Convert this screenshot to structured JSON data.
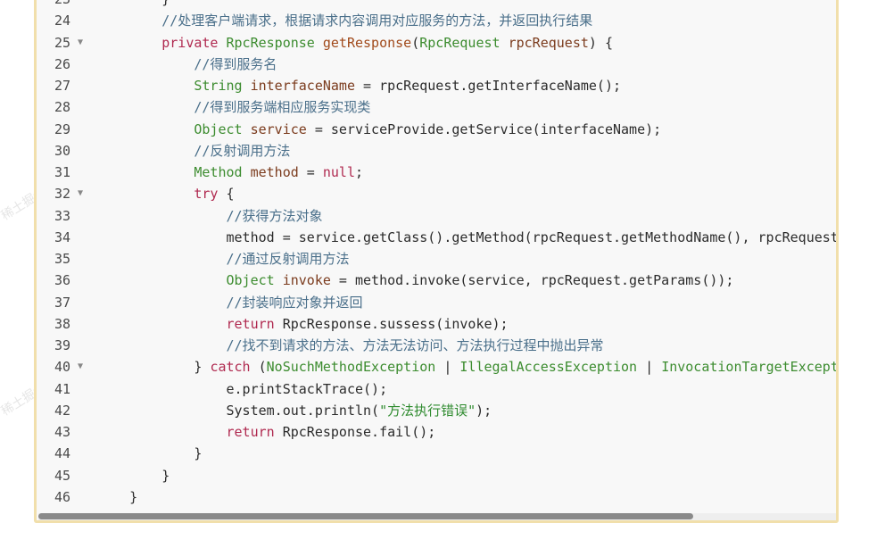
{
  "watermark": "稀土掘金技术社区",
  "lines": [
    {
      "n": "23",
      "fold": false,
      "tokens": [
        {
          "t": "        }",
          "c": ""
        }
      ]
    },
    {
      "n": "24",
      "fold": false,
      "tokens": [
        {
          "t": "        //处理客户端请求，根据请求内容调用对应服务的方法，并返回执行结果",
          "c": "c"
        }
      ]
    },
    {
      "n": "25",
      "fold": true,
      "tokens": [
        {
          "t": "        ",
          "c": ""
        },
        {
          "t": "private",
          "c": "k"
        },
        {
          "t": " ",
          "c": ""
        },
        {
          "t": "RpcResponse",
          "c": "t"
        },
        {
          "t": " ",
          "c": ""
        },
        {
          "t": "getResponse",
          "c": "f"
        },
        {
          "t": "(",
          "c": ""
        },
        {
          "t": "RpcRequest",
          "c": "t"
        },
        {
          "t": " ",
          "c": ""
        },
        {
          "t": "rpcRequest",
          "c": "v"
        },
        {
          "t": ") {",
          "c": ""
        }
      ]
    },
    {
      "n": "26",
      "fold": false,
      "tokens": [
        {
          "t": "            //得到服务名",
          "c": "c"
        }
      ]
    },
    {
      "n": "27",
      "fold": false,
      "tokens": [
        {
          "t": "            ",
          "c": ""
        },
        {
          "t": "String",
          "c": "t"
        },
        {
          "t": " ",
          "c": ""
        },
        {
          "t": "interfaceName",
          "c": "v"
        },
        {
          "t": " = ",
          "c": ""
        },
        {
          "t": "rpcRequest.getInterfaceName();",
          "c": ""
        }
      ]
    },
    {
      "n": "28",
      "fold": false,
      "tokens": [
        {
          "t": "            //得到服务端相应服务实现类",
          "c": "c"
        }
      ]
    },
    {
      "n": "29",
      "fold": false,
      "tokens": [
        {
          "t": "            ",
          "c": ""
        },
        {
          "t": "Object",
          "c": "t"
        },
        {
          "t": " ",
          "c": ""
        },
        {
          "t": "service",
          "c": "v"
        },
        {
          "t": " = ",
          "c": ""
        },
        {
          "t": "serviceProvide.getService(interfaceName);",
          "c": ""
        }
      ]
    },
    {
      "n": "30",
      "fold": false,
      "tokens": [
        {
          "t": "            //反射调用方法",
          "c": "c"
        }
      ]
    },
    {
      "n": "31",
      "fold": false,
      "tokens": [
        {
          "t": "            ",
          "c": ""
        },
        {
          "t": "Method",
          "c": "t"
        },
        {
          "t": " ",
          "c": ""
        },
        {
          "t": "method",
          "c": "v"
        },
        {
          "t": " = ",
          "c": ""
        },
        {
          "t": "null",
          "c": "k"
        },
        {
          "t": ";",
          "c": ""
        }
      ]
    },
    {
      "n": "32",
      "fold": true,
      "tokens": [
        {
          "t": "            ",
          "c": ""
        },
        {
          "t": "try",
          "c": "k"
        },
        {
          "t": " {",
          "c": ""
        }
      ]
    },
    {
      "n": "33",
      "fold": false,
      "tokens": [
        {
          "t": "                //获得方法对象",
          "c": "c"
        }
      ]
    },
    {
      "n": "34",
      "fold": false,
      "tokens": [
        {
          "t": "                method = service.getClass().getMethod(rpcRequest.getMethodName(), rpcRequest.getParamsType());",
          "c": ""
        }
      ]
    },
    {
      "n": "35",
      "fold": false,
      "tokens": [
        {
          "t": "                //通过反射调用方法",
          "c": "c"
        }
      ]
    },
    {
      "n": "36",
      "fold": false,
      "tokens": [
        {
          "t": "                ",
          "c": ""
        },
        {
          "t": "Object",
          "c": "t"
        },
        {
          "t": " ",
          "c": ""
        },
        {
          "t": "invoke",
          "c": "v"
        },
        {
          "t": " = ",
          "c": ""
        },
        {
          "t": "method.invoke(service, rpcRequest.getParams());",
          "c": ""
        }
      ]
    },
    {
      "n": "37",
      "fold": false,
      "tokens": [
        {
          "t": "                //封装响应对象并返回",
          "c": "c"
        }
      ]
    },
    {
      "n": "38",
      "fold": false,
      "tokens": [
        {
          "t": "                ",
          "c": ""
        },
        {
          "t": "return",
          "c": "k"
        },
        {
          "t": " RpcResponse.sussess(invoke);",
          "c": ""
        }
      ]
    },
    {
      "n": "39",
      "fold": false,
      "tokens": [
        {
          "t": "                //找不到请求的方法、方法无法访问、方法执行过程中抛出异常",
          "c": "c"
        }
      ]
    },
    {
      "n": "40",
      "fold": true,
      "tokens": [
        {
          "t": "            } ",
          "c": ""
        },
        {
          "t": "catch",
          "c": "k"
        },
        {
          "t": " (",
          "c": ""
        },
        {
          "t": "NoSuchMethodException",
          "c": "t"
        },
        {
          "t": " | ",
          "c": ""
        },
        {
          "t": "IllegalAccessException",
          "c": "t"
        },
        {
          "t": " | ",
          "c": ""
        },
        {
          "t": "InvocationTargetException",
          "c": "t"
        },
        {
          "t": " e) {",
          "c": ""
        }
      ]
    },
    {
      "n": "41",
      "fold": false,
      "tokens": [
        {
          "t": "                e.printStackTrace();",
          "c": ""
        }
      ]
    },
    {
      "n": "42",
      "fold": false,
      "tokens": [
        {
          "t": "                System.out.println(",
          "c": ""
        },
        {
          "t": "\"方法执行错误\"",
          "c": "s"
        },
        {
          "t": ");",
          "c": ""
        }
      ]
    },
    {
      "n": "43",
      "fold": false,
      "tokens": [
        {
          "t": "                ",
          "c": ""
        },
        {
          "t": "return",
          "c": "k"
        },
        {
          "t": " RpcResponse.fail();",
          "c": ""
        }
      ]
    },
    {
      "n": "44",
      "fold": false,
      "tokens": [
        {
          "t": "            }",
          "c": ""
        }
      ]
    },
    {
      "n": "45",
      "fold": false,
      "tokens": [
        {
          "t": "        }",
          "c": ""
        }
      ]
    },
    {
      "n": "46",
      "fold": false,
      "tokens": [
        {
          "t": "    }",
          "c": ""
        }
      ]
    }
  ],
  "scroll": {
    "position_fraction": 0,
    "visible_fraction": 0.82
  }
}
